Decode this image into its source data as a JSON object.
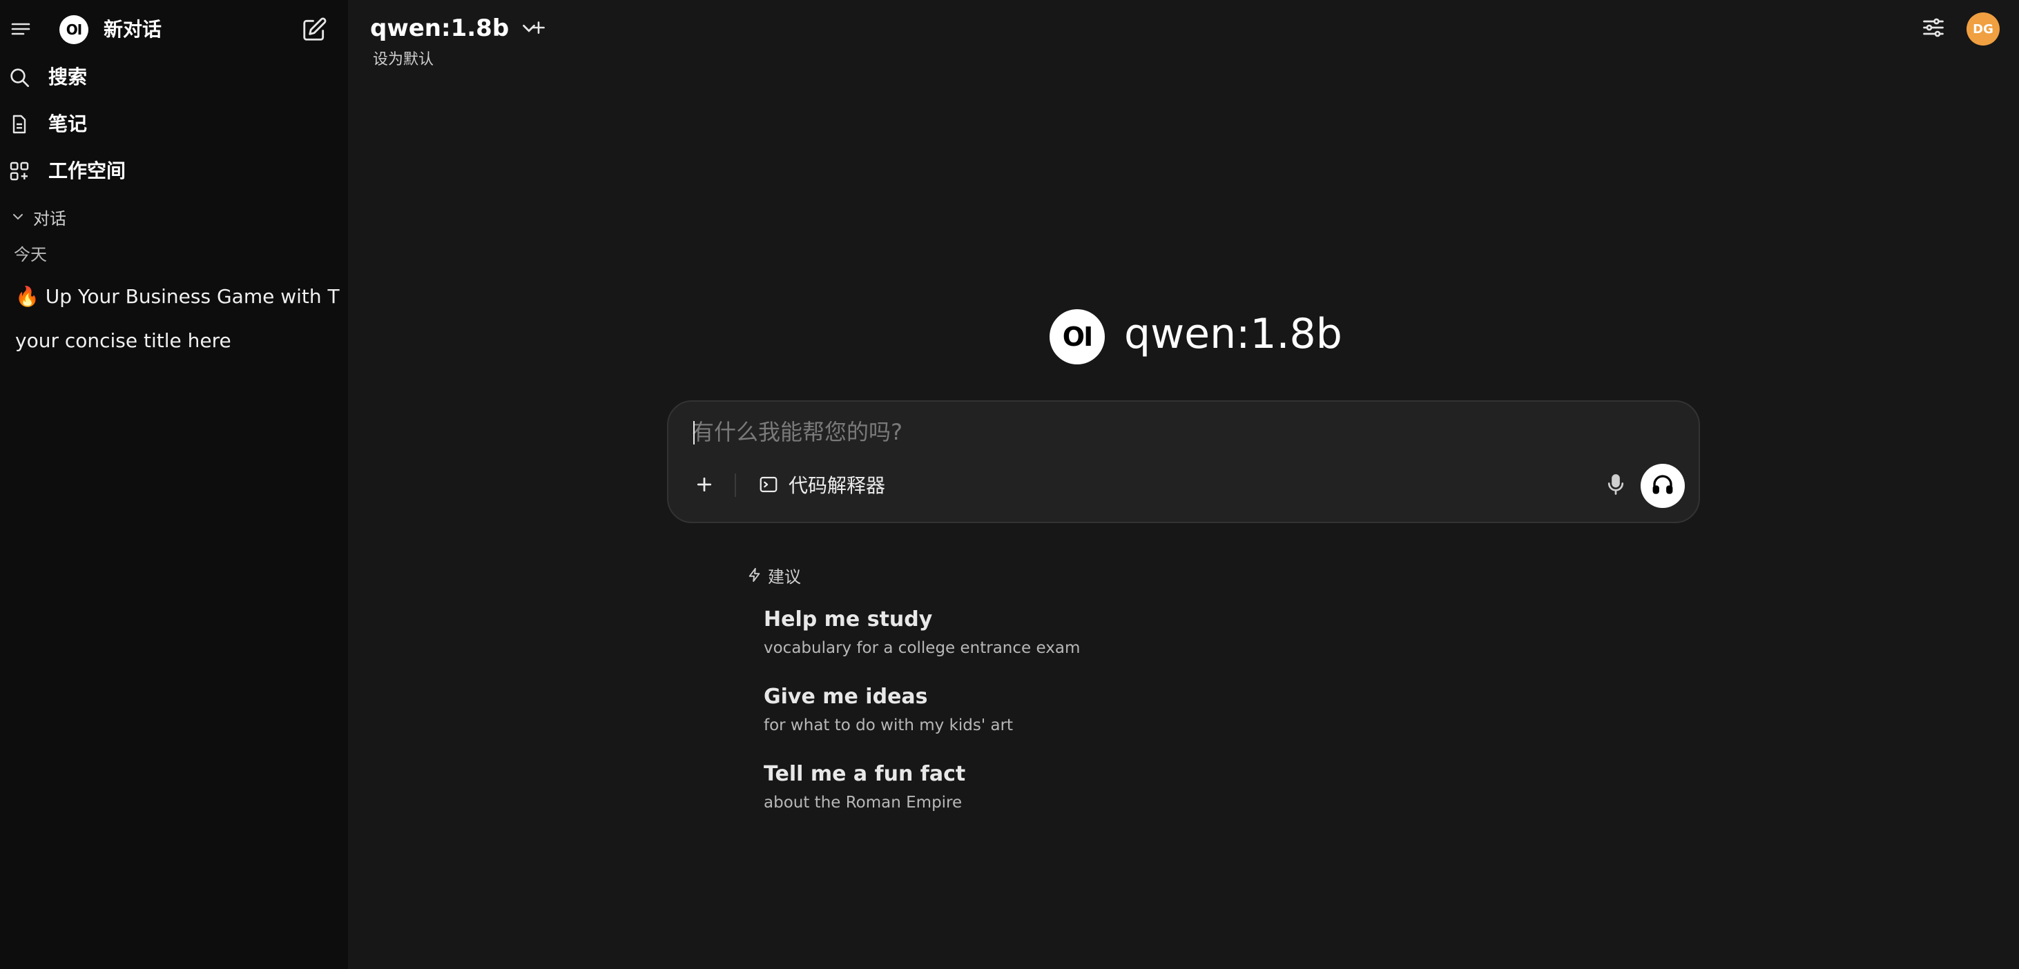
{
  "sidebar": {
    "new_chat_label": "新对话",
    "logo_text": "OI",
    "nav": [
      {
        "label": "搜索",
        "icon": "search-icon"
      },
      {
        "label": "笔记",
        "icon": "notes-icon"
      },
      {
        "label": "工作空间",
        "icon": "workspace-icon"
      }
    ],
    "section_label": "对话",
    "group_label": "今天",
    "chats": [
      {
        "title": "🔥 Up Your Business Game with Th"
      },
      {
        "title": "your concise title here"
      }
    ]
  },
  "header": {
    "model_name": "qwen:1.8b",
    "set_default": "设为默认",
    "avatar_initials": "DG",
    "avatar_color": "#f0a040"
  },
  "hero": {
    "logo_text": "OI",
    "model_name": "qwen:1.8b"
  },
  "composer": {
    "placeholder": "有什么我能帮您的吗?",
    "value": "",
    "tool_label": "代码解释器"
  },
  "suggestions": {
    "header": "建议",
    "items": [
      {
        "title": "Help me study",
        "subtitle": "vocabulary for a college entrance exam"
      },
      {
        "title": "Give me ideas",
        "subtitle": "for what to do with my kids' art"
      },
      {
        "title": "Tell me a fun fact",
        "subtitle": "about the Roman Empire"
      }
    ]
  },
  "colors": {
    "background": "#171717",
    "sidebar": "#0d0d0d",
    "composer": "#222222"
  }
}
